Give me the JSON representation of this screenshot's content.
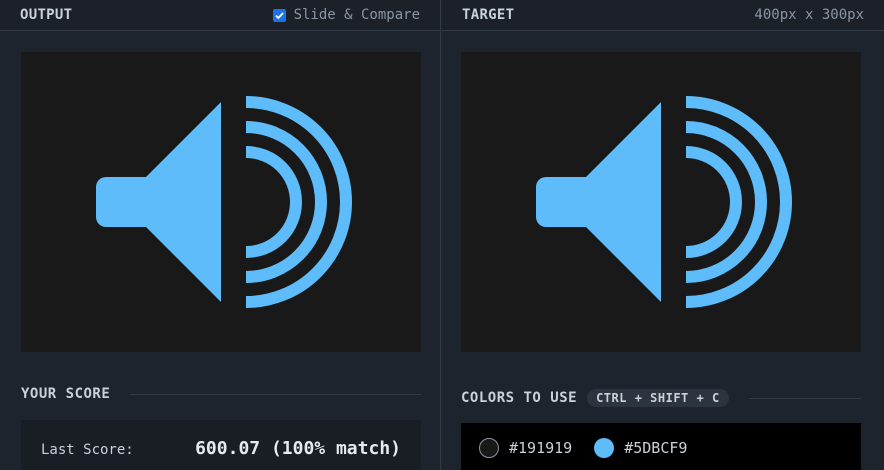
{
  "output_panel": {
    "title": "OUTPUT",
    "slide_compare_label": "Slide & Compare",
    "slide_compare_checked": true
  },
  "target_panel": {
    "title": "TARGET",
    "dimensions": "400px x 300px"
  },
  "score": {
    "heading": "YOUR SCORE",
    "last_score_label": "Last Score:",
    "last_score_value": "600.07 (100% match)"
  },
  "colors": {
    "heading": "COLORS TO USE",
    "shortcut": "CTRL + SHIFT + C",
    "swatches": [
      {
        "hex": "#191919",
        "label": "#191919"
      },
      {
        "hex": "#5DBCF9",
        "label": "#5DBCF9"
      }
    ]
  },
  "theme": {
    "canvas_bg": "#191919",
    "speaker_color": "#5DBCF9",
    "checkbox_accent": "#1a73e8"
  },
  "icons": {
    "canvas_image": "speaker-volume-icon"
  }
}
